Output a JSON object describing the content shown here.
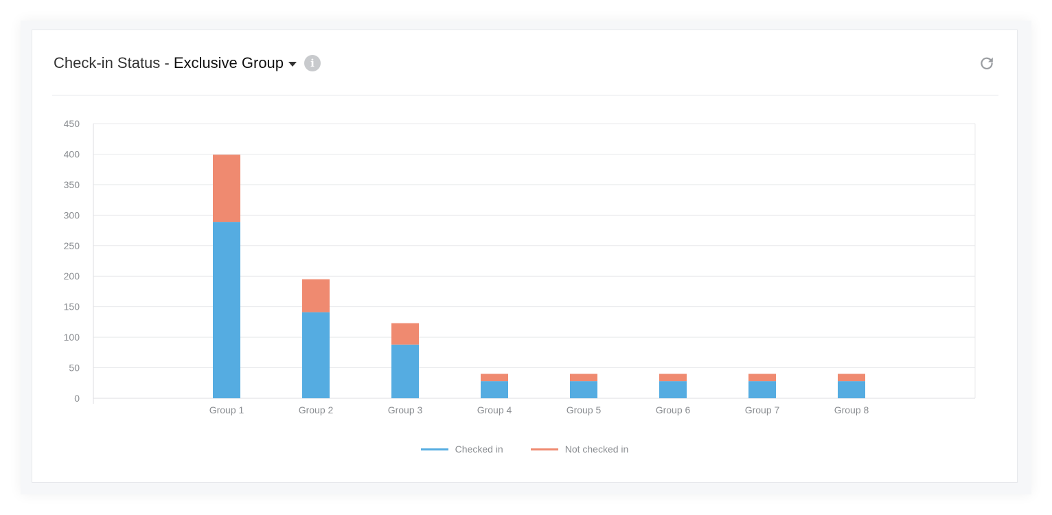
{
  "header": {
    "title_prefix": "Check-in Status - ",
    "title_selected": "Exclusive Group",
    "caret_icon": "caret-down-icon",
    "info_icon": "info-icon",
    "info_glyph": "i",
    "refresh_icon": "refresh-icon"
  },
  "colors": {
    "checked_in": "#55ace1",
    "not_checked_in": "#ef8a70",
    "grid": "#e8e9eb",
    "axis_text": "#8a8d91"
  },
  "legend": [
    {
      "label": "Checked in",
      "color": "#55ace1"
    },
    {
      "label": "Not checked in",
      "color": "#ef8a70"
    }
  ],
  "chart_data": {
    "type": "bar",
    "stacked": true,
    "categories": [
      "Group 1",
      "Group 2",
      "Group 3",
      "Group 4",
      "Group 5",
      "Group 6",
      "Group 7",
      "Group 8"
    ],
    "series": [
      {
        "name": "Checked in",
        "values": [
          289,
          141,
          88,
          28,
          28,
          28,
          28,
          28
        ]
      },
      {
        "name": "Not checked in",
        "values": [
          110,
          54,
          35,
          12,
          12,
          12,
          12,
          12
        ]
      }
    ],
    "ylim": [
      0,
      450
    ],
    "yticks": [
      0,
      50,
      100,
      150,
      200,
      250,
      300,
      350,
      400,
      450
    ],
    "grid": true,
    "legend_position": "bottom"
  }
}
